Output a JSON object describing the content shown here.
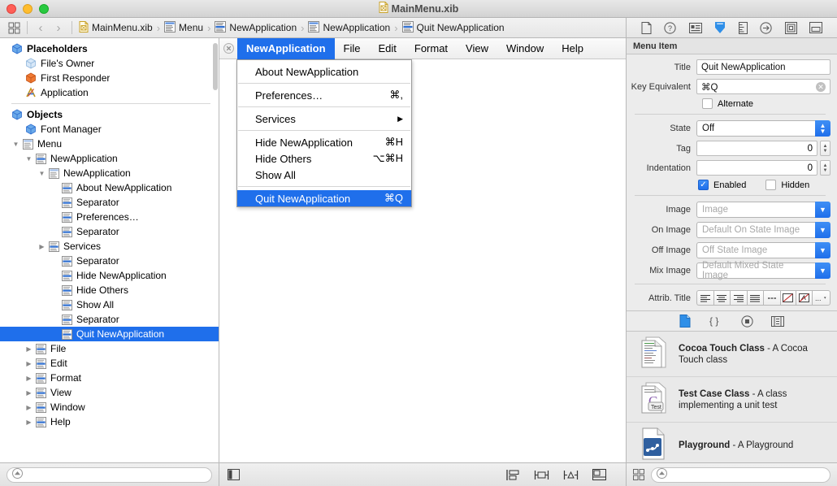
{
  "window": {
    "title": "MainMenu.xib",
    "traffic_lights": [
      "close",
      "minimize",
      "zoom"
    ]
  },
  "jumpbar": {
    "back_icon": "chevron-left-icon",
    "forward_icon": "chevron-right-icon",
    "grid_icon": "editor-grid-icon",
    "breadcrumbs": [
      {
        "label": "MainMenu.xib",
        "icon": "xib-file-icon"
      },
      {
        "label": "Menu",
        "icon": "menu-icon"
      },
      {
        "label": "NewApplication",
        "icon": "menu-item-icon"
      },
      {
        "label": "NewApplication",
        "icon": "menu-icon"
      },
      {
        "label": "Quit NewApplication",
        "icon": "menu-item-icon"
      }
    ],
    "inspector_tabs": [
      "file-inspector-icon",
      "quick-help-icon",
      "identity-inspector-icon",
      "attributes-inspector-icon",
      "size-inspector-icon",
      "connections-inspector-icon",
      "bindings-inspector-icon",
      "view-effects-icon"
    ],
    "selected_inspector_tab": 3
  },
  "outline": {
    "sections": [
      {
        "header": "Placeholders",
        "items": [
          {
            "label": "File's Owner",
            "depth": 1,
            "icon": "cube-icon",
            "twisty": "none"
          },
          {
            "label": "First Responder",
            "depth": 1,
            "icon": "first-responder-icon",
            "twisty": "none"
          },
          {
            "label": "Application",
            "depth": 1,
            "icon": "application-icon",
            "twisty": "none"
          }
        ]
      },
      {
        "header": "Objects",
        "items": [
          {
            "label": "Font Manager",
            "depth": 1,
            "icon": "cube-icon",
            "twisty": "none"
          },
          {
            "label": "Menu",
            "depth": 1,
            "icon": "menu-icon",
            "twisty": "open"
          },
          {
            "label": "NewApplication",
            "depth": 2,
            "icon": "menu-item-icon",
            "twisty": "open"
          },
          {
            "label": "NewApplication",
            "depth": 3,
            "icon": "menu-icon",
            "twisty": "open"
          },
          {
            "label": "About NewApplication",
            "depth": 4,
            "icon": "menu-item-icon",
            "twisty": "none"
          },
          {
            "label": "Separator",
            "depth": 4,
            "icon": "menu-item-icon",
            "twisty": "none"
          },
          {
            "label": "Preferences…",
            "depth": 4,
            "icon": "menu-item-icon",
            "twisty": "none"
          },
          {
            "label": "Separator",
            "depth": 4,
            "icon": "menu-item-icon",
            "twisty": "none"
          },
          {
            "label": "Services",
            "depth": 4,
            "icon": "menu-item-icon",
            "twisty": "closed"
          },
          {
            "label": "Separator",
            "depth": 4,
            "icon": "menu-item-icon",
            "twisty": "none"
          },
          {
            "label": "Hide NewApplication",
            "depth": 4,
            "icon": "menu-item-icon",
            "twisty": "none"
          },
          {
            "label": "Hide Others",
            "depth": 4,
            "icon": "menu-item-icon",
            "twisty": "none"
          },
          {
            "label": "Show All",
            "depth": 4,
            "icon": "menu-item-icon",
            "twisty": "none"
          },
          {
            "label": "Separator",
            "depth": 4,
            "icon": "menu-item-icon",
            "twisty": "none"
          },
          {
            "label": "Quit NewApplication",
            "depth": 4,
            "icon": "menu-item-icon",
            "twisty": "none",
            "selected": true
          },
          {
            "label": "File",
            "depth": 2,
            "icon": "menu-item-icon",
            "twisty": "closed"
          },
          {
            "label": "Edit",
            "depth": 2,
            "icon": "menu-item-icon",
            "twisty": "closed"
          },
          {
            "label": "Format",
            "depth": 2,
            "icon": "menu-item-icon",
            "twisty": "closed"
          },
          {
            "label": "View",
            "depth": 2,
            "icon": "menu-item-icon",
            "twisty": "closed"
          },
          {
            "label": "Window",
            "depth": 2,
            "icon": "menu-item-icon",
            "twisty": "closed"
          },
          {
            "label": "Help",
            "depth": 2,
            "icon": "menu-item-icon",
            "twisty": "closed"
          }
        ]
      }
    ],
    "filter_placeholder": ""
  },
  "canvas": {
    "menubar": {
      "close_icon": "canvas-close-icon",
      "items": [
        {
          "label": "NewApplication",
          "active": true
        },
        {
          "label": "File",
          "active": false
        },
        {
          "label": "Edit",
          "active": false
        },
        {
          "label": "Format",
          "active": false
        },
        {
          "label": "View",
          "active": false
        },
        {
          "label": "Window",
          "active": false
        },
        {
          "label": "Help",
          "active": false
        }
      ]
    },
    "dropdown": [
      {
        "label": "About NewApplication",
        "shortcut": "",
        "type": "item"
      },
      {
        "type": "separator"
      },
      {
        "label": "Preferences…",
        "shortcut": "⌘,",
        "type": "item"
      },
      {
        "type": "separator"
      },
      {
        "label": "Services",
        "shortcut": "",
        "type": "submenu"
      },
      {
        "type": "separator"
      },
      {
        "label": "Hide NewApplication",
        "shortcut": "⌘H",
        "type": "item"
      },
      {
        "label": "Hide Others",
        "shortcut": "⌥⌘H",
        "type": "item"
      },
      {
        "label": "Show All",
        "shortcut": "",
        "type": "item"
      },
      {
        "type": "separator"
      },
      {
        "label": "Quit NewApplication",
        "shortcut": "⌘Q",
        "type": "item",
        "selected": true
      }
    ]
  },
  "inspector": {
    "header": "Menu Item",
    "fields": {
      "title_label": "Title",
      "title_value": "Quit NewApplication",
      "key_equivalent_label": "Key Equivalent",
      "key_equivalent_value": "⌘Q",
      "alternate_label": "Alternate",
      "alternate_checked": false,
      "state_label": "State",
      "state_value": "Off",
      "tag_label": "Tag",
      "tag_value": "0",
      "indentation_label": "Indentation",
      "indentation_value": "0",
      "enabled_label": "Enabled",
      "enabled_checked": true,
      "hidden_label": "Hidden",
      "hidden_checked": false,
      "image_label": "Image",
      "image_placeholder": "Image",
      "on_image_label": "On Image",
      "on_image_placeholder": "Default On State Image",
      "off_image_label": "Off Image",
      "off_image_placeholder": "Off State Image",
      "mix_image_label": "Mix Image",
      "mix_image_placeholder": "Default Mixed State Image",
      "attrib_title_label": "Attrib. Title",
      "attrib_segments": [
        "align-left-icon",
        "align-center-icon",
        "align-right-icon",
        "align-justify-icon",
        "align-natural-icon",
        "text-color-icon",
        "text-style-icon",
        "more-options-icon"
      ]
    }
  },
  "library": {
    "tabs": [
      "file-template-icon",
      "code-snippet-icon",
      "object-library-icon",
      "media-library-icon"
    ],
    "selected_tab": 0,
    "items": [
      {
        "name": "Cocoa Touch Class",
        "desc": "- A Cocoa Touch class",
        "icon": "cocoa-touch-class-icon"
      },
      {
        "name": "Test Case Class",
        "desc": "- A class implementing a unit test",
        "icon": "test-case-class-icon"
      },
      {
        "name": "Playground",
        "desc": "- A Playground",
        "icon": "playground-icon"
      }
    ],
    "filter_placeholder": ""
  },
  "bottombar": {
    "outline_filter_icon": "filter-icon",
    "canvas_toggle_icon": "canvas-toggle-icon",
    "editor_tools": [
      "stack-view-icon",
      "align-icon",
      "pin-icon",
      "resolve-issues-icon"
    ],
    "library_grid_icon": "library-grid-icon",
    "library_filter_icon": "filter-icon"
  },
  "colors": {
    "accent": "#1f6feb",
    "selection": "#1f6feb",
    "panel": "#ececec",
    "border": "#b8b8b8"
  }
}
